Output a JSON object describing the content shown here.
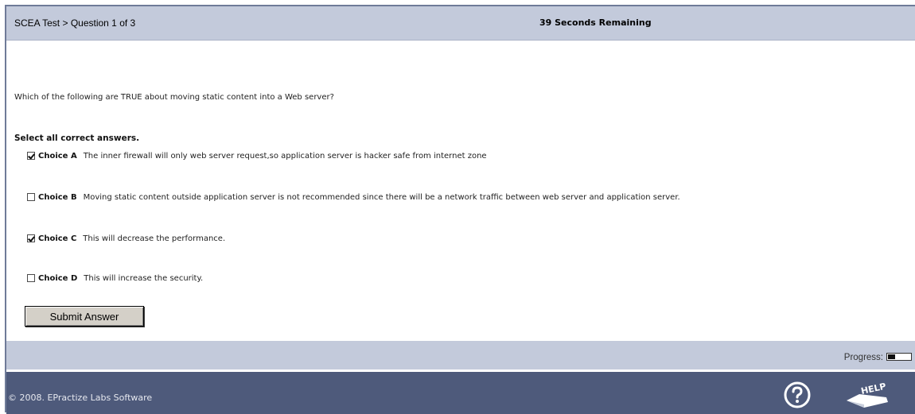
{
  "header": {
    "breadcrumb": "SCEA Test > Question 1 of 3",
    "timer": "39 Seconds Remaining"
  },
  "question": {
    "text": "Which of the following are TRUE about moving static content into a Web server?",
    "instructions": "Select all correct answers."
  },
  "choices": [
    {
      "label": "Choice A",
      "text": "The inner firewall will only web server request,so application server is hacker safe from internet zone",
      "checked": true
    },
    {
      "label": "Choice B",
      "text": "Moving static content outside application server is not recommended since there will be a network traffic between web server and application server.",
      "checked": false
    },
    {
      "label": "Choice C",
      "text": "This will decrease the performance.",
      "checked": true
    },
    {
      "label": "Choice D",
      "text": "This will increase the security.",
      "checked": false
    }
  ],
  "submit_label": "Submit Answer",
  "progress": {
    "label": "Progress:",
    "fraction": 0.33
  },
  "footer": {
    "copyright": "© 2008. EPractize Labs Software",
    "help_icon": "question-circle-icon",
    "help_badge_icon": "help-badge-icon",
    "help_badge_text": "HELP"
  },
  "colors": {
    "header_bg": "#c3cadb",
    "footer_bg": "#4e5a7b",
    "frame_border": "#6f7b98"
  }
}
